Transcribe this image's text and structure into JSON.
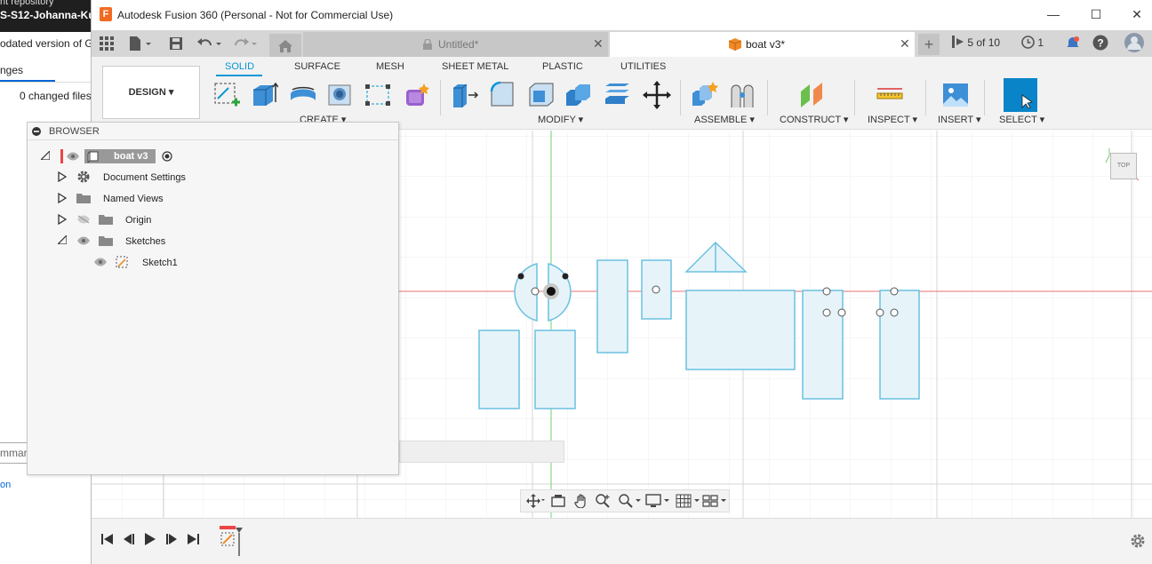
{
  "background_app": {
    "title_line1": "nt repository",
    "title_line2": "S-S12-Johanna-Kuh",
    "updated_text": "odated version of G",
    "tab_label": "nges",
    "changed_files": "0 changed files",
    "summary_placeholder": "mmary",
    "commit_text": "on"
  },
  "window": {
    "title": "Autodesk Fusion 360 (Personal - Not for Commercial Use)",
    "logo_letter": "F",
    "minimize": "—",
    "maximize": "☐",
    "close": "✕"
  },
  "tabs": {
    "untitled_label": "Untitled*",
    "active_label": "boat v3*",
    "close_glyph": "✕",
    "plus_glyph": "+",
    "jobs_label": "5 of 10",
    "notifications_count": "1"
  },
  "toolbar": {
    "workspace": "DESIGN ▾",
    "tabs": [
      "SOLID",
      "SURFACE",
      "MESH",
      "SHEET METAL",
      "PLASTIC",
      "UTILITIES"
    ],
    "groups": {
      "create": "CREATE ▾",
      "modify": "MODIFY ▾",
      "assemble": "ASSEMBLE ▾",
      "construct": "CONSTRUCT ▾",
      "inspect": "INSPECT ▾",
      "insert": "INSERT ▾",
      "select": "SELECT ▾"
    }
  },
  "browser": {
    "title": "BROWSER",
    "root": "boat v3",
    "items": [
      {
        "label": "Document Settings"
      },
      {
        "label": "Named Views"
      },
      {
        "label": "Origin"
      },
      {
        "label": "Sketches"
      },
      {
        "label": "Sketch1"
      }
    ]
  },
  "viewcube": {
    "label": "TOP"
  },
  "colors": {
    "accent": "#0696d7",
    "sketch_stroke": "#6cc0e0",
    "sketch_fill": "#e6f4fa",
    "x_axis": "#e87070",
    "y_axis": "#6fd36f"
  }
}
